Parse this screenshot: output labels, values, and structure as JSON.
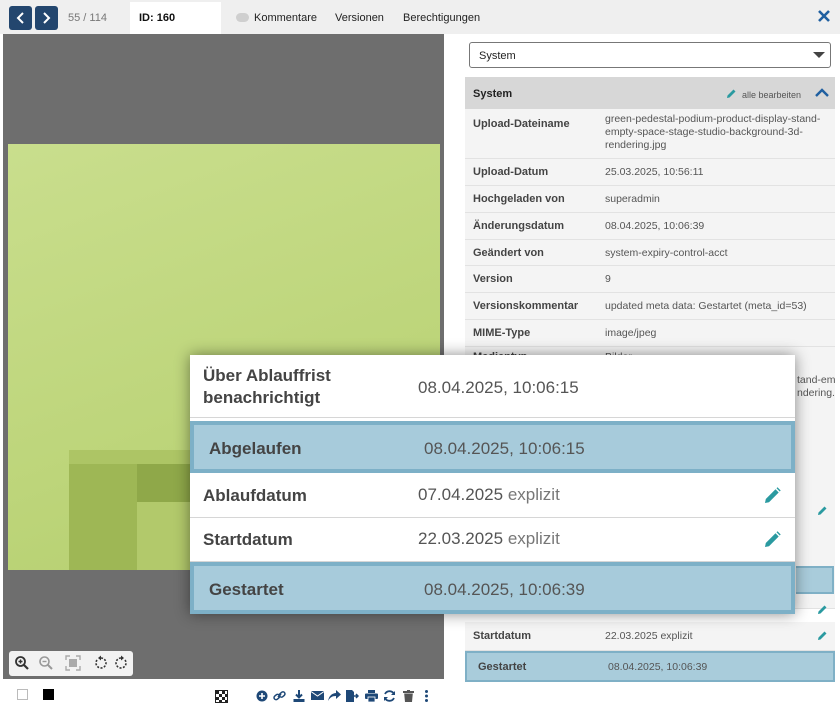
{
  "topbar": {
    "counter": "55 / 114",
    "id_tab": "ID: 160",
    "tabs": [
      "Kommentare",
      "Versionen",
      "Berechtigungen"
    ]
  },
  "panel": {
    "select_value": "System",
    "section_title": "System",
    "edit_all": "alle bearbeiten",
    "rows": [
      {
        "key": "Upload-Dateiname",
        "value": "green-pedestal-podium-product-display-stand-empty-space-stage-studio-background-3d-rendering.jpg"
      },
      {
        "key": "Upload-Datum",
        "value": "25.03.2025, 10:56:11"
      },
      {
        "key": "Hochgeladen von",
        "value": "superadmin"
      },
      {
        "key": "Änderungsdatum",
        "value": "08.04.2025, 10:06:39"
      },
      {
        "key": "Geändert von",
        "value": "system-expiry-control-acct"
      },
      {
        "key": "Version",
        "value": "9"
      },
      {
        "key": "Versionskommentar",
        "value": "updated meta data: Gestartet (meta_id=53)"
      },
      {
        "key": "MIME-Type",
        "value": "image/jpeg"
      }
    ],
    "partial_behind": [
      "Medientyp",
      "Bilder",
      "tand-em",
      "ndering."
    ],
    "bottom_rows": [
      {
        "key": "Startdatum",
        "value": "22.03.2025 explizit"
      },
      {
        "key": "Gestartet",
        "value": "08.04.2025, 10:06:39"
      }
    ]
  },
  "overlay": {
    "rows": [
      {
        "key": "Über Ablauffrist benachrichtigt",
        "value": "08.04.2025, 10:06:15"
      },
      {
        "key": "Abgelaufen",
        "value": "08.04.2025, 10:06:15"
      },
      {
        "key": "Ablaufdatum",
        "value": "07.04.2025",
        "sub": "explizit"
      },
      {
        "key": "Startdatum",
        "value": "22.03.2025",
        "sub": "explizit"
      },
      {
        "key": "Gestartet",
        "value": "08.04.2025, 10:06:39"
      }
    ]
  },
  "colors": {
    "nav": "#23466e",
    "highlight": "#a7cbdb",
    "highlight_border": "#7db0c7",
    "accent_pencil": "#2a9aa0",
    "close": "#1f5fa0"
  }
}
